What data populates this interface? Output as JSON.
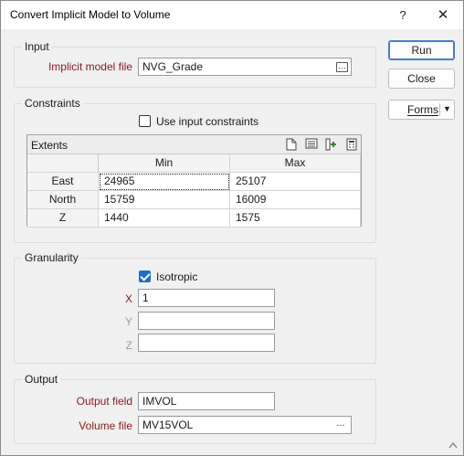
{
  "window": {
    "title": "Convert Implicit Model to Volume",
    "help_label": "?",
    "close_label": "✕"
  },
  "buttons": {
    "run": "Run",
    "close": "Close",
    "forms": "Forms",
    "forms_arrow": "▼"
  },
  "input_group": {
    "label": "Input",
    "implicit_model_label": "Implicit model file",
    "implicit_model_value": "NVG_Grade",
    "browse_glyph": "…"
  },
  "constraints_group": {
    "label": "Constraints",
    "use_input_constraints_label": "Use input constraints",
    "use_input_constraints_checked": false,
    "extents": {
      "title": "Extents",
      "columns": [
        "Min",
        "Max"
      ],
      "rows": [
        {
          "label": "East",
          "min": "24965",
          "max": "25107"
        },
        {
          "label": "North",
          "min": "15759",
          "max": "16009"
        },
        {
          "label": "Z",
          "min": "1440",
          "max": "1575"
        }
      ]
    }
  },
  "granularity_group": {
    "label": "Granularity",
    "isotropic_label": "Isotropic",
    "isotropic_checked": true,
    "x_label": "X",
    "x_value": "1",
    "y_label": "Y",
    "y_value": "",
    "z_label": "Z",
    "z_value": ""
  },
  "output_group": {
    "label": "Output",
    "output_field_label": "Output field",
    "output_field_value": "IMVOL",
    "volume_file_label": "Volume file",
    "volume_file_value": "MV15VOL",
    "browse_glyph": "..."
  },
  "colors": {
    "accent": "#1e6ec8",
    "required_label": "#8b1a1a",
    "run_border": "#4a7cc9"
  }
}
